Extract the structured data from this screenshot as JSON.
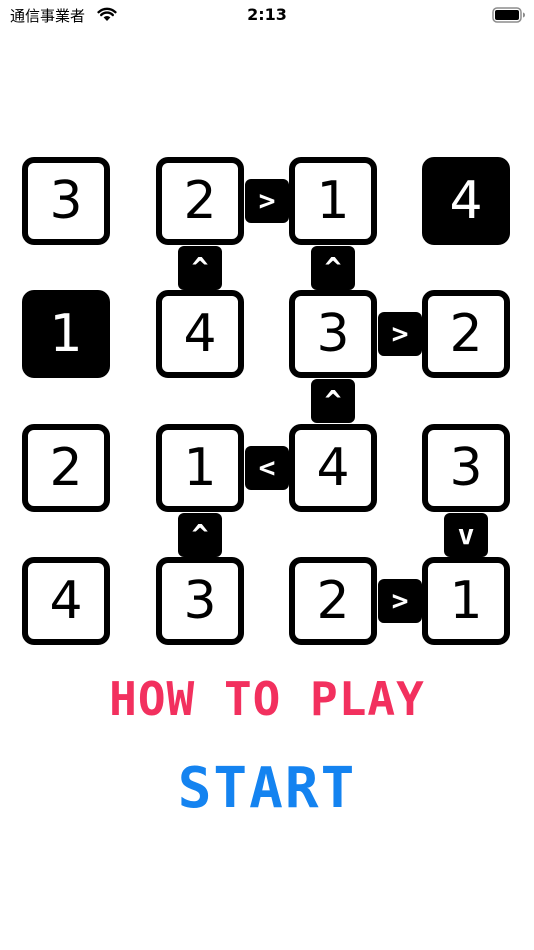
{
  "status_bar": {
    "carrier": "通信事業者",
    "time": "2:13"
  },
  "board": {
    "size": 4,
    "cells": [
      [
        {
          "value": "3",
          "fixed": false
        },
        {
          "value": "2",
          "fixed": false
        },
        {
          "value": "1",
          "fixed": false
        },
        {
          "value": "4",
          "fixed": true
        }
      ],
      [
        {
          "value": "1",
          "fixed": true
        },
        {
          "value": "4",
          "fixed": false
        },
        {
          "value": "3",
          "fixed": false
        },
        {
          "value": "2",
          "fixed": false
        }
      ],
      [
        {
          "value": "2",
          "fixed": false
        },
        {
          "value": "1",
          "fixed": false
        },
        {
          "value": "4",
          "fixed": false
        },
        {
          "value": "3",
          "fixed": false
        }
      ],
      [
        {
          "value": "4",
          "fixed": false
        },
        {
          "value": "3",
          "fixed": false
        },
        {
          "value": "2",
          "fixed": false
        },
        {
          "value": "1",
          "fixed": false
        }
      ]
    ],
    "horizontal_signs": [
      {
        "row": 0,
        "after_col": 1,
        "symbol": ">"
      },
      {
        "row": 1,
        "after_col": 2,
        "symbol": ">"
      },
      {
        "row": 2,
        "after_col": 1,
        "symbol": "<"
      },
      {
        "row": 3,
        "after_col": 2,
        "symbol": ">"
      }
    ],
    "vertical_signs": [
      {
        "after_row": 0,
        "col": 1,
        "symbol": "^"
      },
      {
        "after_row": 0,
        "col": 2,
        "symbol": "^"
      },
      {
        "after_row": 1,
        "col": 2,
        "symbol": "^"
      },
      {
        "after_row": 2,
        "col": 1,
        "symbol": "^"
      },
      {
        "after_row": 2,
        "col": 3,
        "symbol": "v"
      }
    ]
  },
  "menu": {
    "how_to_play": "HOW TO PLAY",
    "start": "START"
  },
  "colors": {
    "how_to_play": "#f2305e",
    "start": "#1483f0",
    "cell_border": "#000000",
    "fixed_cell_background": "#000000"
  }
}
